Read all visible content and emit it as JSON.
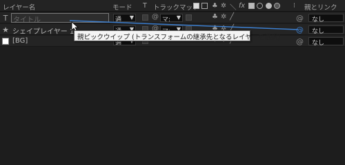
{
  "header": {
    "layer_name": "レイヤー名",
    "mode": "モード",
    "t": "T",
    "track_matte": "トラックマット",
    "parent_link": "親とリンク"
  },
  "layers": [
    {
      "type": "text",
      "icon": "T",
      "name_placeholder": "タイトル",
      "mode": "通",
      "matte": "マ:",
      "parent": "なし"
    },
    {
      "type": "shape",
      "icon": "★",
      "name": "シェイプレイヤー 1",
      "mode": "通",
      "matte": "マ:",
      "parent": "なし"
    },
    {
      "type": "solid",
      "name": "[BG]",
      "mode": "通",
      "parent": "なし",
      "swatch_color": "#ffffff"
    }
  ],
  "tooltip": "親ピックウイップ (トランスフォームの継承先となるレイヤーを選択)",
  "pickwhip_line_color": "#3c7fd0"
}
